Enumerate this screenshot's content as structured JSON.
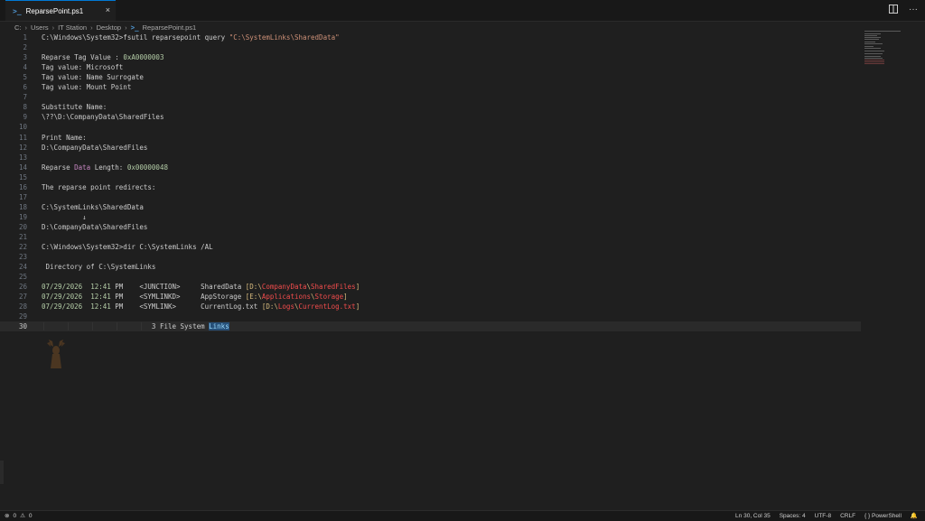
{
  "tab": {
    "icon": "powershell-icon",
    "label": "ReparsePoint.ps1",
    "close": "×"
  },
  "breadcrumb": {
    "items": [
      "C:",
      "Users",
      "IT Station",
      "Desktop"
    ],
    "file": "ReparsePoint.ps1"
  },
  "lines": [
    {
      "n": "1",
      "segs": [
        {
          "t": "C:\\Windows\\System32>fsutil reparsepoint query "
        },
        {
          "t": "\"C:\\SystemLinks\\SharedData\"",
          "c": "str"
        }
      ]
    },
    {
      "n": "2",
      "segs": []
    },
    {
      "n": "3",
      "segs": [
        {
          "t": "Reparse Tag Value : "
        },
        {
          "t": "0xA0000003",
          "c": "num"
        }
      ]
    },
    {
      "n": "4",
      "segs": [
        {
          "t": "Tag value: Microsoft"
        }
      ]
    },
    {
      "n": "5",
      "segs": [
        {
          "t": "Tag value: Name Surrogate"
        }
      ]
    },
    {
      "n": "6",
      "segs": [
        {
          "t": "Tag value: Mount Point"
        }
      ]
    },
    {
      "n": "7",
      "segs": []
    },
    {
      "n": "8",
      "segs": [
        {
          "t": "Substitute Name:"
        }
      ]
    },
    {
      "n": "9",
      "segs": [
        {
          "t": "\\??\\D:\\CompanyData\\SharedFiles"
        }
      ]
    },
    {
      "n": "10",
      "segs": []
    },
    {
      "n": "11",
      "segs": [
        {
          "t": "Print Name:"
        }
      ]
    },
    {
      "n": "12",
      "segs": [
        {
          "t": "D:\\CompanyData\\SharedFiles"
        }
      ]
    },
    {
      "n": "13",
      "segs": []
    },
    {
      "n": "14",
      "segs": [
        {
          "t": "Reparse "
        },
        {
          "t": "Data",
          "c": "kw"
        },
        {
          "t": " Length: "
        },
        {
          "t": "0x00000048",
          "c": "num"
        }
      ]
    },
    {
      "n": "15",
      "segs": []
    },
    {
      "n": "16",
      "segs": [
        {
          "t": "The reparse point redirects:"
        }
      ]
    },
    {
      "n": "17",
      "segs": []
    },
    {
      "n": "18",
      "segs": [
        {
          "t": "C:\\SystemLinks\\SharedData"
        }
      ]
    },
    {
      "n": "19",
      "segs": [
        {
          "t": "          ↓"
        }
      ]
    },
    {
      "n": "20",
      "segs": [
        {
          "t": "D:\\CompanyData\\SharedFiles"
        }
      ]
    },
    {
      "n": "21",
      "segs": []
    },
    {
      "n": "22",
      "segs": [
        {
          "t": "C:\\Windows\\System32>dir C:\\SystemLinks /AL"
        }
      ]
    },
    {
      "n": "23",
      "segs": []
    },
    {
      "n": "24",
      "segs": [
        {
          "t": " Directory of C:\\SystemLinks"
        }
      ]
    },
    {
      "n": "25",
      "segs": []
    },
    {
      "n": "26",
      "segs": [
        {
          "t": "07/29/2026",
          "c": "time"
        },
        {
          "t": "  "
        },
        {
          "t": "12:41",
          "c": "time"
        },
        {
          "t": " PM    <JUNCTION>     SharedData "
        },
        {
          "t": "[",
          "c": "brk"
        },
        {
          "t": "D:\\",
          "c": "brk"
        },
        {
          "t": "CompanyData",
          "c": "path"
        },
        {
          "t": "\\",
          "c": "brk"
        },
        {
          "t": "SharedFiles",
          "c": "path"
        },
        {
          "t": "]",
          "c": "brk"
        }
      ]
    },
    {
      "n": "27",
      "segs": [
        {
          "t": "07/29/2026",
          "c": "time"
        },
        {
          "t": "  "
        },
        {
          "t": "12:41",
          "c": "time"
        },
        {
          "t": " PM    <SYMLINKD>     AppStorage "
        },
        {
          "t": "[",
          "c": "brk"
        },
        {
          "t": "E:\\",
          "c": "brk"
        },
        {
          "t": "Applications",
          "c": "path"
        },
        {
          "t": "\\",
          "c": "brk"
        },
        {
          "t": "Storage",
          "c": "path"
        },
        {
          "t": "]",
          "c": "brk"
        }
      ]
    },
    {
      "n": "28",
      "segs": [
        {
          "t": "07/29/2026",
          "c": "time"
        },
        {
          "t": "  "
        },
        {
          "t": "12:41",
          "c": "time"
        },
        {
          "t": " PM    <SYMLINK>      CurrentLog.txt "
        },
        {
          "t": "[",
          "c": "brk"
        },
        {
          "t": "D:\\",
          "c": "brk"
        },
        {
          "t": "Logs",
          "c": "path"
        },
        {
          "t": "\\",
          "c": "brk"
        },
        {
          "t": "CurrentLog.txt",
          "c": "path"
        },
        {
          "t": "]",
          "c": "brk"
        }
      ]
    },
    {
      "n": "29",
      "segs": []
    },
    {
      "n": "30",
      "active": true,
      "segs": [
        {
          "t": "│     │     │     │     │",
          "c": "guide"
        },
        {
          "t": "  3 File System "
        },
        {
          "t": "Links",
          "c": "hl"
        }
      ]
    }
  ],
  "status": {
    "errors": "0",
    "warnings": "0",
    "position": "Ln 30, Col 35",
    "spaces": "Spaces: 4",
    "encoding": "UTF-8",
    "eol": "CRLF",
    "language": "PowerShell",
    "language_icon": "braces-icon",
    "bell_icon": "bell-icon"
  },
  "colors": {
    "accent": "#0078d4",
    "string": "#ce9178",
    "number": "#b5cea8",
    "keyword": "#c586c0",
    "path": "#f14c4c",
    "bracket": "#d7ba7d"
  }
}
